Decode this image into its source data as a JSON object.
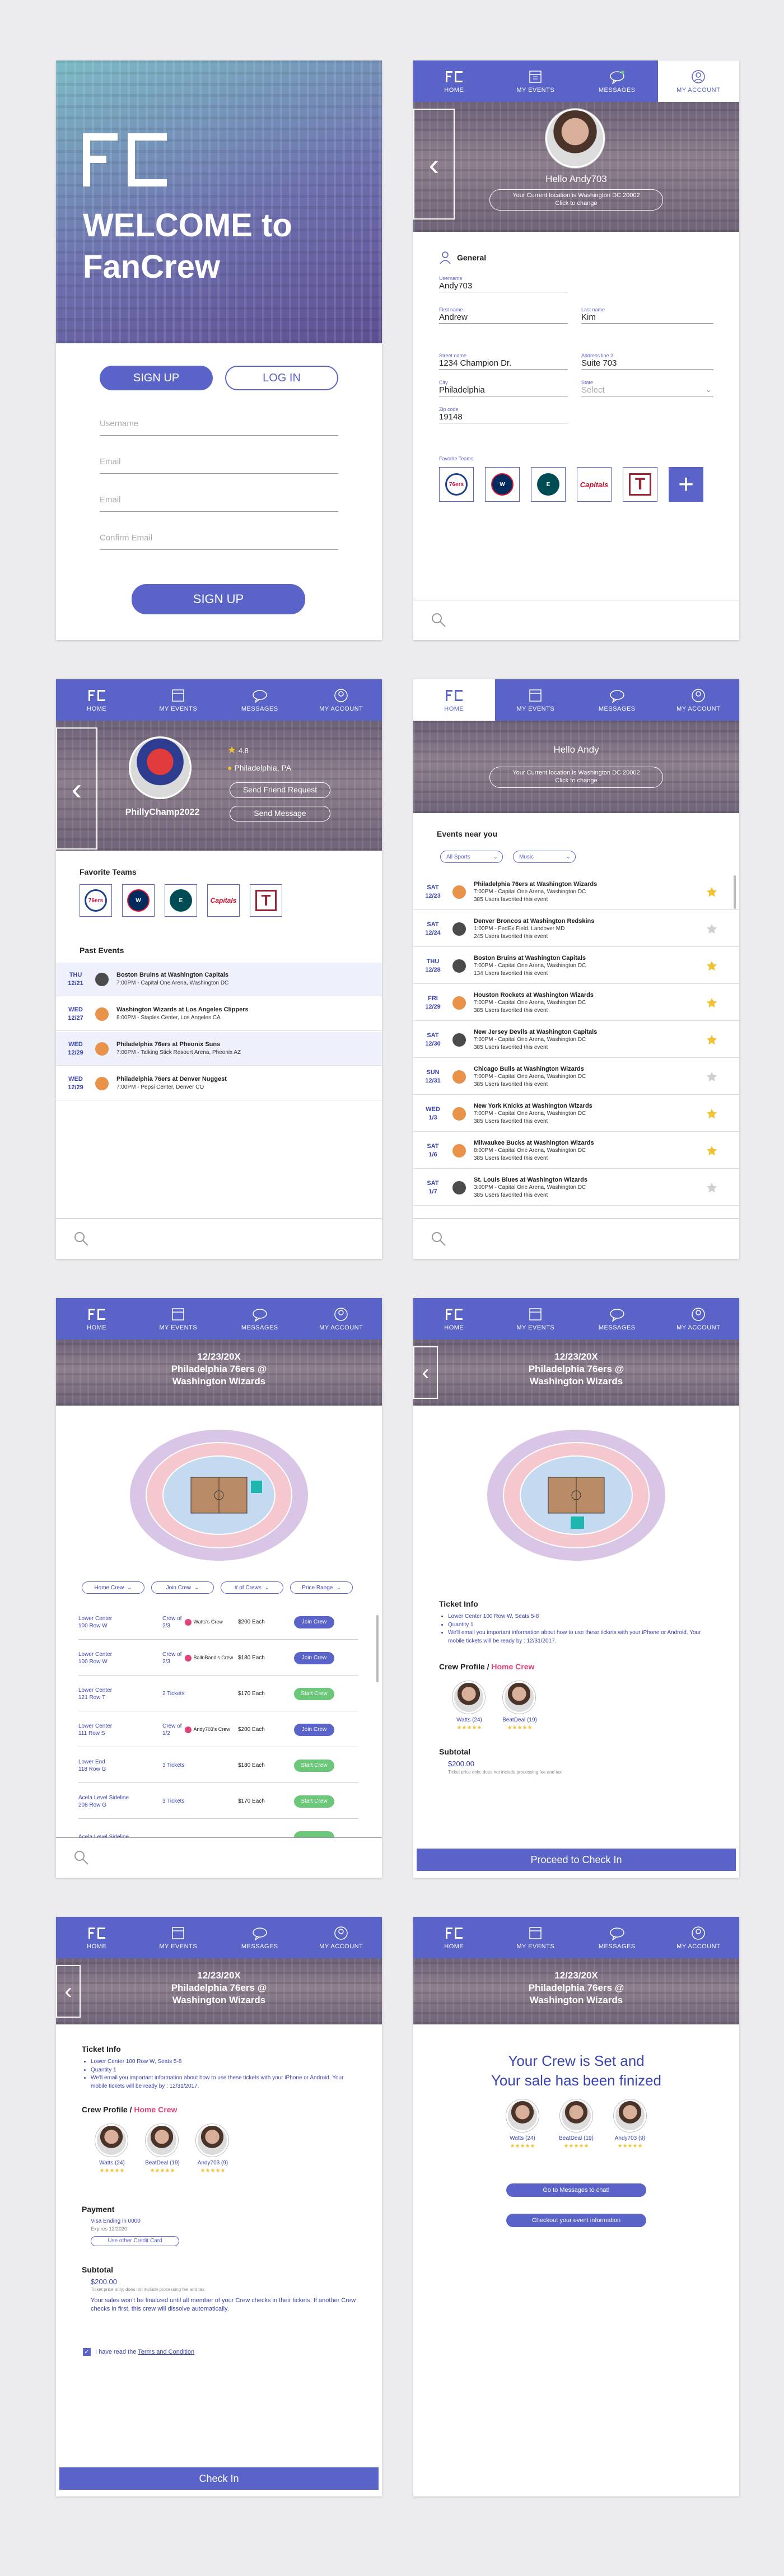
{
  "nav": {
    "home": "HOME",
    "events": "MY EVENTS",
    "messages": "MESSAGES",
    "account": "MY ACCOUNT"
  },
  "welcome": {
    "title_line1": "WELCOME to",
    "title_line2": "FanCrew",
    "signup_tab": "SIGN UP",
    "login_tab": "LOG IN",
    "username_ph": "Username",
    "email_ph": "Email",
    "email2_ph": "Email",
    "confirm_ph": "Confirm Email",
    "signup_button": "SIGN UP"
  },
  "account": {
    "greeting": "Hello Andy703",
    "location_pill_l1": "Your Current location is Washington DC 20002",
    "location_pill_l2": "Click to change",
    "section": "General",
    "fields": {
      "username_l": "Username",
      "username_v": "Andy703",
      "first_l": "First name",
      "first_v": "Andrew",
      "last_l": "Last name",
      "last_v": "Kim",
      "street_l": "Street name",
      "street_v": "1234 Champion Dr.",
      "addr2_l": "Address line 2",
      "addr2_v": "Suite 703",
      "city_l": "City",
      "city_v": "Philadelphia",
      "state_l": "State",
      "state_v": "Select",
      "zip_l": "Zip code",
      "zip_v": "19148"
    },
    "fav_label": "Favorite Teams"
  },
  "teams": {
    "sixers": "76ers",
    "wizards": "W",
    "eagles": "E",
    "caps": "Capitals",
    "temple": "T"
  },
  "profile": {
    "rating": "4.8",
    "city": "Philadelphia, PA",
    "friend_btn": "Send Friend Request",
    "msg_btn": "Send Message",
    "name": "PhillyChamp2022",
    "fav_title": "Favorite Teams",
    "past_title": "Past Events",
    "past": [
      {
        "day": "THU",
        "date": "12/21",
        "title": "Boston Bruins at Washington Capitals",
        "sub": "7:00PM - Capital One Arena, Washington DC"
      },
      {
        "day": "WED",
        "date": "12/27",
        "title": "Washington Wizards at Los Angeles Clippers",
        "sub": "8:00PM - Staples Center, Los Angeles CA"
      },
      {
        "day": "WED",
        "date": "12/29",
        "title": "Philadelphia 76ers at Pheonix Suns",
        "sub": "7:00PM - Talking Stick Resourt Arena, Pheonix AZ"
      },
      {
        "day": "WED",
        "date": "12/29",
        "title": "Philadelphia 76ers at Denver Nuggest",
        "sub": "7:00PM - Pepsi Center, Denver CO"
      }
    ]
  },
  "home": {
    "greeting": "Hello Andy",
    "pill_l1": "Your Current location is Washington DC 20002",
    "pill_l2": "Click to change",
    "events_title": "Events near you",
    "filter1": "All Sports",
    "filter2": "Music",
    "events": [
      {
        "day": "SAT",
        "date": "12/23",
        "title": "Philadelphia 76ers at Washington Wizards",
        "l2": "7:00PM - Capital One Arena, Washington DC",
        "l3": "385 Users favorited this event",
        "fav": true
      },
      {
        "day": "SAT",
        "date": "12/24",
        "title": "Denver Broncos at Washington Redskins",
        "l2": "1:00PM - FedEx Field, Landover MD",
        "l3": "245 Users favorited this event",
        "fav": false
      },
      {
        "day": "THU",
        "date": "12/28",
        "title": "Boston Bruins at Washington Capitals",
        "l2": "7:00PM - Capital One Arena, Washington DC",
        "l3": "134 Users favorited this event",
        "fav": true
      },
      {
        "day": "FRI",
        "date": "12/29",
        "title": "Houston Rockets at Washington Wizards",
        "l2": "7:00PM - Capital One Arena, Washington DC",
        "l3": "385 Users favorited this event",
        "fav": true
      },
      {
        "day": "SAT",
        "date": "12/30",
        "title": "New Jersey Devils at Washington Capitals",
        "l2": "7:00PM - Capital One Arena, Washington DC",
        "l3": "385 Users favorited this event",
        "fav": true
      },
      {
        "day": "SUN",
        "date": "12/31",
        "title": "Chicago Bulls at Washington Wizards",
        "l2": "7:00PM - Capital One Arena, Washington DC",
        "l3": "385 Users favorited this event",
        "fav": false
      },
      {
        "day": "WED",
        "date": "1/3",
        "title": "New York Knicks at Washington Wizards",
        "l2": "7:00PM - Capital One Arena, Washington DC",
        "l3": "385 Users favorited this event",
        "fav": true
      },
      {
        "day": "SAT",
        "date": "1/6",
        "title": "Milwaukee Bucks at Washington Wizards",
        "l2": "8:00PM - Capital One Arena, Washington DC",
        "l3": "385 Users favorited this event",
        "fav": true
      },
      {
        "day": "SAT",
        "date": "1/7",
        "title": "St. Louis Blues at Washington Wizards",
        "l2": "3:00PM - Capital One Arena, Washington DC",
        "l3": "385 Users favorited this event",
        "fav": false
      }
    ]
  },
  "event": {
    "date": "12/23/20X",
    "line1": "Philadelphia 76ers @",
    "line2": "Washington Wizards",
    "filters": [
      "Home Crew",
      "Join Crew",
      "# of Crews",
      "Price Range"
    ],
    "seats": [
      {
        "sec": "Lower Center",
        "sec2": "100 Row W",
        "crew": "Crew of",
        "crew2": "2/3",
        "price": "$200 Each",
        "btn": "Join Crew",
        "type": "join",
        "badge": "Watts's Crew"
      },
      {
        "sec": "Lower Center",
        "sec2": "100 Row W",
        "crew": "Crew of",
        "crew2": "2/3",
        "price": "$180 Each",
        "btn": "Join Crew",
        "type": "join",
        "badge": "BallnBand's Crew"
      },
      {
        "sec": "Lower Center",
        "sec2": "121 Row T",
        "crew": "2 Tickets",
        "crew2": "",
        "price": "$170 Each",
        "btn": "Start Crew",
        "type": "start",
        "badge": ""
      },
      {
        "sec": "Lower Center",
        "sec2": "111 Row S",
        "crew": "Crew of",
        "crew2": "1/2",
        "price": "$200 Each",
        "btn": "Join Crew",
        "type": "join",
        "badge": "Andy703's Crew"
      },
      {
        "sec": "Lower End",
        "sec2": "118 Row G",
        "crew": "3 Tickets",
        "crew2": "",
        "price": "$180 Each",
        "btn": "Start Crew",
        "type": "start",
        "badge": ""
      },
      {
        "sec": "Acela Level Sideline",
        "sec2": "208 Row G",
        "crew": "3 Tickets",
        "crew2": "",
        "price": "$170 Each",
        "btn": "Start Crew",
        "type": "start",
        "badge": ""
      },
      {
        "sec": "Acela Level Sideline",
        "sec2": "",
        "crew": "",
        "crew2": "",
        "price": "",
        "btn": "",
        "type": "start",
        "badge": ""
      }
    ]
  },
  "checkin": {
    "ticket_title": "Ticket Info",
    "t1": "Lower Center 100 Row W, Seats 5-8",
    "t2": "Quantity 1",
    "t3": "We'll email you important information about how to use these tickets with your iPhone or Android. Your mobile tickets will be ready by : 12/31/2017.",
    "crew_title": "Crew Profile",
    "home_crew": "Home Crew",
    "m1": "Watts",
    "m1r": "(24)",
    "m2": "BeatDeal",
    "m2r": "(19)",
    "m3": "Andy703",
    "m3r": "(9)",
    "subtotal_title": "Subtotal",
    "subtotal": "$200.00",
    "subtotal_note": "Ticket price only; does not include processing fee and tax",
    "proceed": "Proceed to Check In",
    "payment_title": "Payment",
    "card": "Visa Ending in 0000",
    "expires": "Expires 12/2020",
    "other_card": "Use other Credit Card",
    "warn": "Your sales won't be finalized until all member of your Crew checks in their tickets. If another Crew checks in first, this crew will dissolve automatically.",
    "agree": "I have read the",
    "terms": "Terms and Condition",
    "checkin": "Check In"
  },
  "final": {
    "l1": "Your Crew is Set and",
    "l2": "Your sale has been finized",
    "chat_btn": "Go to Messages to chat!",
    "info_btn": "Checkout your event information"
  },
  "colors": {
    "primary": "#5a63c8",
    "crew_red": "#e0457a",
    "start_green": "#6cc77a",
    "star": "#f1c232"
  }
}
